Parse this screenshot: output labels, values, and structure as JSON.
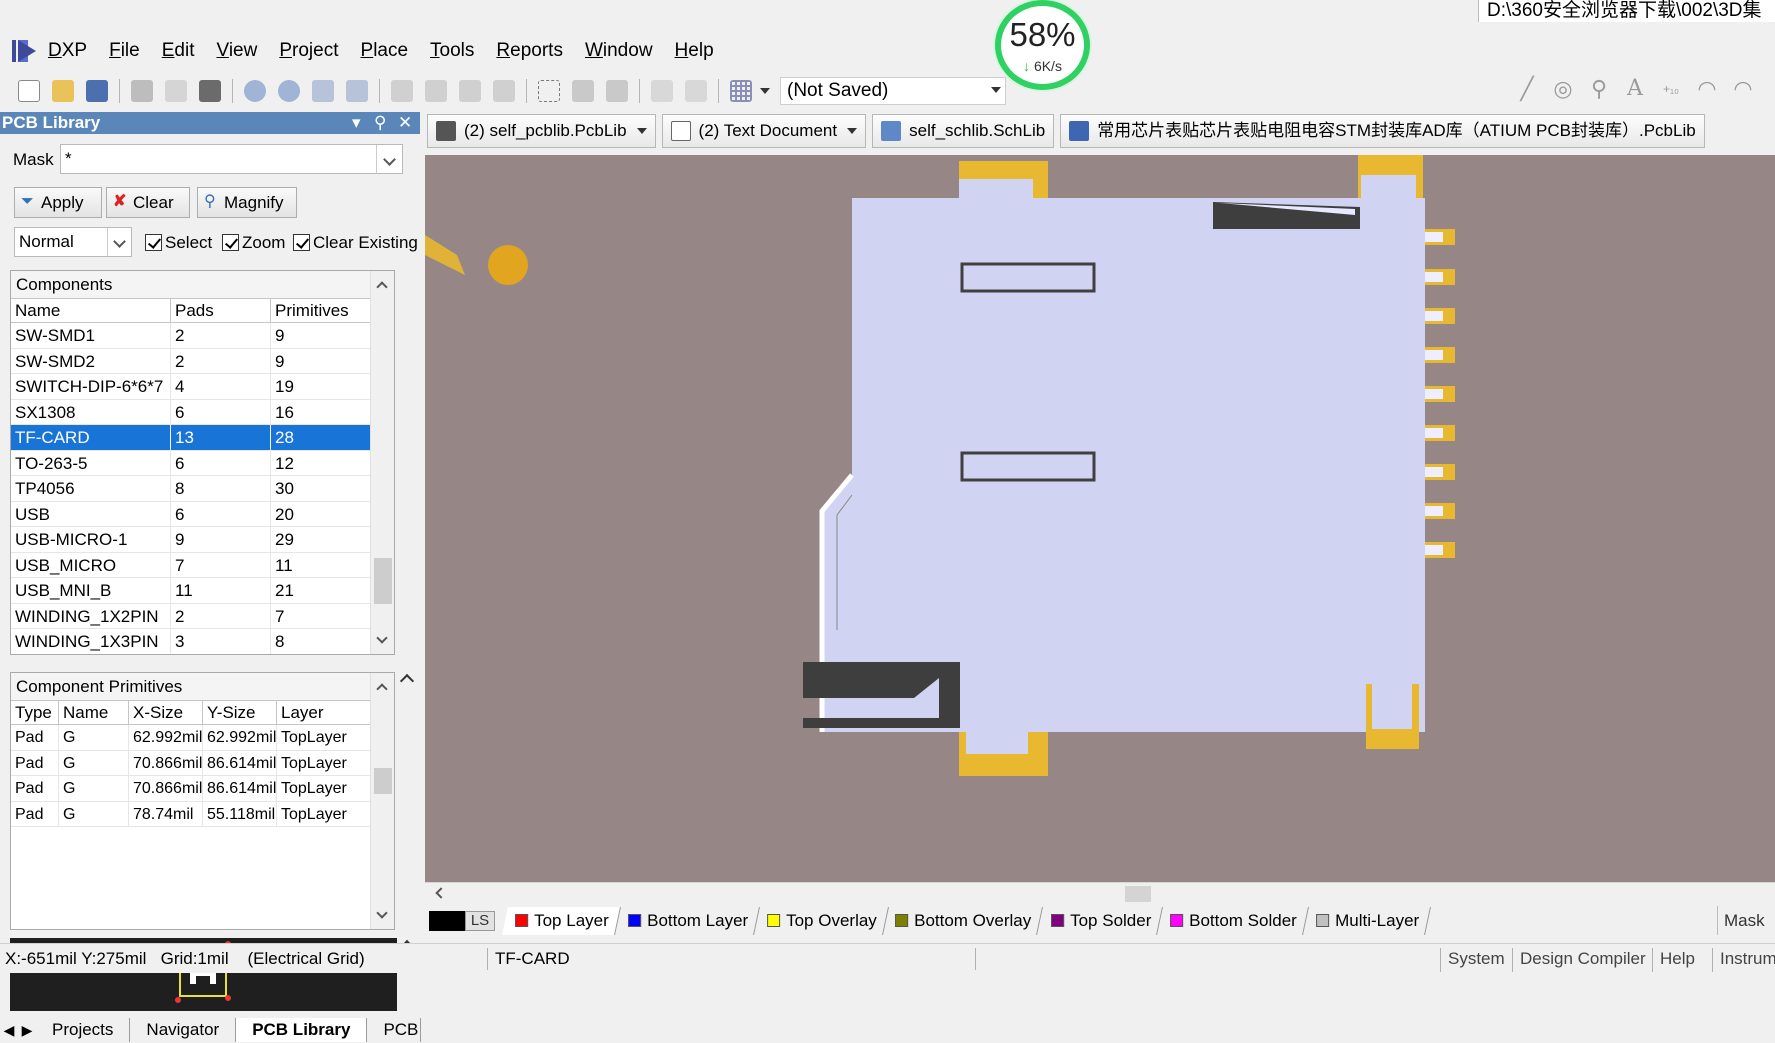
{
  "title_path": "D:\\360安全浏览器下载\\002\\3D集",
  "net_monitor": {
    "percent": "58%",
    "speed": "6K/s",
    "speed_fraction": 0.58
  },
  "menu": {
    "logo_label": "DXP",
    "items": [
      "File",
      "Edit",
      "View",
      "Project",
      "Place",
      "Tools",
      "Reports",
      "Window",
      "Help"
    ]
  },
  "toolbar": {
    "variant_select": "(Not Saved)"
  },
  "panel": {
    "title": "PCB Library",
    "mask_label": "Mask",
    "mask_value": "*",
    "apply_label": "Apply",
    "clear_label": "Clear",
    "magnify_label": "Magnify",
    "mode_value": "Normal",
    "select_label": "Select",
    "zoom_label": "Zoom",
    "clear_existing_label": "Clear Existing",
    "components": {
      "title": "Components",
      "columns": [
        "Name",
        "Pads",
        "Primitives"
      ],
      "rows": [
        [
          "SW-SMD1",
          "2",
          "9"
        ],
        [
          "SW-SMD2",
          "2",
          "9"
        ],
        [
          "SWITCH-DIP-6*6*7",
          "4",
          "19"
        ],
        [
          "SX1308",
          "6",
          "16"
        ],
        [
          "TF-CARD",
          "13",
          "28"
        ],
        [
          "TO-263-5",
          "6",
          "12"
        ],
        [
          "TP4056",
          "8",
          "30"
        ],
        [
          "USB",
          "6",
          "20"
        ],
        [
          "USB-MICRO-1",
          "9",
          "29"
        ],
        [
          "USB_MICRO",
          "7",
          "11"
        ],
        [
          "USB_MNI_B",
          "11",
          "21"
        ],
        [
          "WINDING_1X2PIN",
          "2",
          "7"
        ],
        [
          "WINDING_1X3PIN",
          "3",
          "8"
        ]
      ],
      "selected_index": 4
    },
    "primitives": {
      "title": "Component Primitives",
      "columns": [
        "Type",
        "Name",
        "X-Size",
        "Y-Size",
        "Layer"
      ],
      "rows": [
        [
          "Pad",
          "G",
          "62.992mil",
          "62.992mil",
          "TopLayer"
        ],
        [
          "Pad",
          "G",
          "70.866mil",
          "86.614mil",
          "TopLayer"
        ],
        [
          "Pad",
          "G",
          "70.866mil",
          "86.614mil",
          "TopLayer"
        ],
        [
          "Pad",
          "G",
          "78.74mil",
          "55.118mil",
          "TopLayer"
        ]
      ]
    },
    "tabs": [
      "Projects",
      "Navigator",
      "PCB Library",
      "PCB"
    ],
    "active_tab": "PCB Library"
  },
  "doc_tabs": [
    {
      "label": "(2) self_pcblib.PcbLib",
      "icon": "pcblib-icon",
      "dropdown": true
    },
    {
      "label": "(2) Text Document",
      "icon": "text-document-icon",
      "dropdown": true
    },
    {
      "label": "self_schlib.SchLib",
      "icon": "schlib-icon",
      "dropdown": false
    },
    {
      "label": "常用芯片表贴芯片表贴电阻电容STM封装库AD库（ATIUM PCB封装库）.PcbLib",
      "icon": "pcblib-web-icon",
      "dropdown": false
    }
  ],
  "layers": {
    "ls_label": "LS",
    "items": [
      {
        "label": "Top Layer",
        "color": "#ff0000"
      },
      {
        "label": "Bottom Layer",
        "color": "#0000ff"
      },
      {
        "label": "Top Overlay",
        "color": "#ffff00"
      },
      {
        "label": "Bottom Overlay",
        "color": "#808000"
      },
      {
        "label": "Top Solder",
        "color": "#800080"
      },
      {
        "label": "Bottom Solder",
        "color": "#ff00ff"
      },
      {
        "label": "Multi-Layer",
        "color": "#c0c0c0"
      }
    ],
    "mask_label": "Mask"
  },
  "status": {
    "coords": "X:-651mil Y:275mil",
    "grid": "Grid:1mil",
    "grid_type": "(Electrical Grid)",
    "component": "TF-CARD",
    "buttons": [
      "System",
      "Design Compiler",
      "Help",
      "Instrum"
    ]
  },
  "colors": {
    "canvas_bg": "#968686",
    "board_body": "#d0d4f2",
    "pad_gold": "#e8b830",
    "selection_blue": "#1874d6",
    "panel_header": "#5a86b9"
  }
}
